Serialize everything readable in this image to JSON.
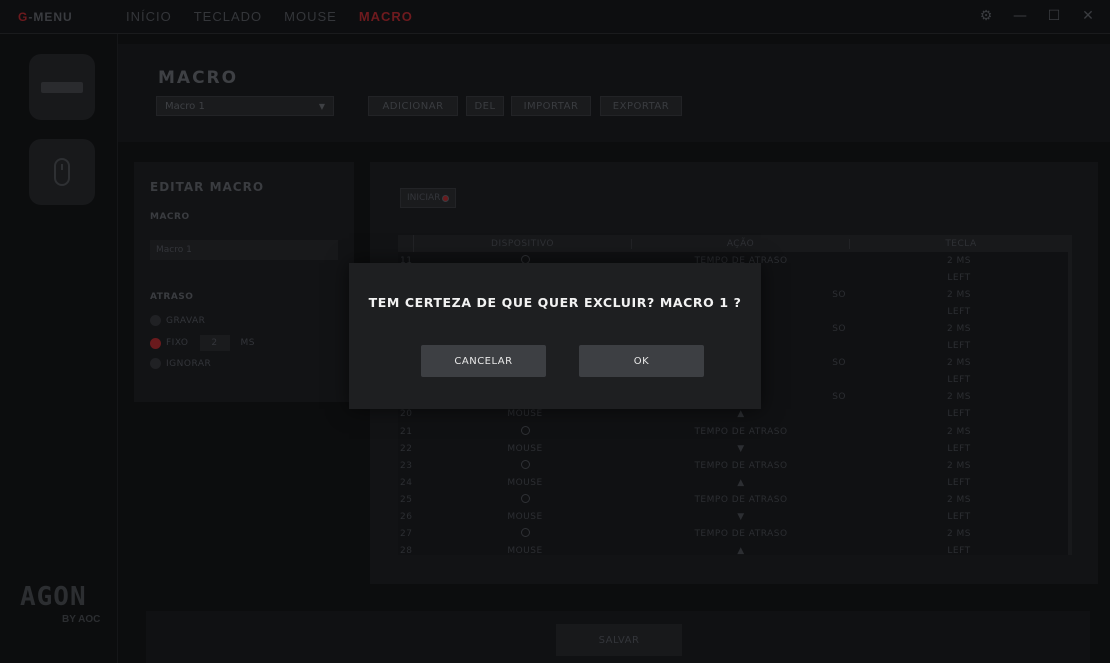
{
  "brand": {
    "prefix": "G",
    "rest": "-MENU"
  },
  "nav": {
    "tabs": [
      "INÍCIO",
      "TECLADO",
      "MOUSE",
      "MACRO"
    ],
    "active": "MACRO"
  },
  "window_controls": {
    "settings": "⚙",
    "minimize": "—",
    "maximize": "☐",
    "close": "✕"
  },
  "sidebar": {
    "logo": "AGON",
    "logo_sub": "BY AOC"
  },
  "macro": {
    "title": "MACRO",
    "selected": "Macro 1",
    "buttons": {
      "add": "ADICIONAR",
      "del": "DEL",
      "import": "IMPORTAR",
      "export": "EXPORTAR"
    }
  },
  "edit": {
    "title": "EDITAR MACRO",
    "macro_label": "MACRO",
    "macro_name": "Macro 1",
    "delay_label": "ATRASO",
    "record": "GRAVAR",
    "fixed": "FIXO",
    "fixed_value": "2",
    "fixed_unit": "MS",
    "ignore": "IGNORAR"
  },
  "table": {
    "start_label": "INICIAR",
    "headers": {
      "device": "DISPOSITIVO",
      "action": "AÇÃO",
      "key": "TECLA"
    },
    "rows": [
      {
        "n": "11",
        "device": "clock",
        "action": "TEMPO DE ATRASO",
        "key": "2 MS"
      },
      {
        "n": "",
        "device": "",
        "action": "",
        "key": "LEFT"
      },
      {
        "n": "",
        "device": "",
        "action": "SO",
        "key": "2 MS"
      },
      {
        "n": "",
        "device": "",
        "action": "",
        "key": "LEFT"
      },
      {
        "n": "",
        "device": "",
        "action": "SO",
        "key": "2 MS"
      },
      {
        "n": "",
        "device": "",
        "action": "",
        "key": "LEFT"
      },
      {
        "n": "",
        "device": "",
        "action": "SO",
        "key": "2 MS"
      },
      {
        "n": "",
        "device": "",
        "action": "",
        "key": "LEFT"
      },
      {
        "n": "",
        "device": "",
        "action": "SO",
        "key": "2 MS"
      },
      {
        "n": "20",
        "device": "MOUSE",
        "action": "▲",
        "key": "LEFT"
      },
      {
        "n": "21",
        "device": "clock",
        "action": "TEMPO DE ATRASO",
        "key": "2 MS"
      },
      {
        "n": "22",
        "device": "MOUSE",
        "action": "▼",
        "key": "LEFT"
      },
      {
        "n": "23",
        "device": "clock",
        "action": "TEMPO DE ATRASO",
        "key": "2 MS"
      },
      {
        "n": "24",
        "device": "MOUSE",
        "action": "▲",
        "key": "LEFT"
      },
      {
        "n": "25",
        "device": "clock",
        "action": "TEMPO DE ATRASO",
        "key": "2 MS"
      },
      {
        "n": "26",
        "device": "MOUSE",
        "action": "▼",
        "key": "LEFT"
      },
      {
        "n": "27",
        "device": "clock",
        "action": "TEMPO DE ATRASO",
        "key": "2 MS"
      },
      {
        "n": "28",
        "device": "MOUSE",
        "action": "▲",
        "key": "LEFT"
      }
    ]
  },
  "footer": {
    "save": "SALVAR"
  },
  "dialog": {
    "message": "TEM CERTEZA DE QUE QUER EXCLUIR? MACRO 1 ?",
    "cancel": "CANCELAR",
    "ok": "OK"
  },
  "colors": {
    "accent": "#6e1a1e",
    "modal_bg": "#1e1f21",
    "modal_button": "#3d3f43"
  }
}
